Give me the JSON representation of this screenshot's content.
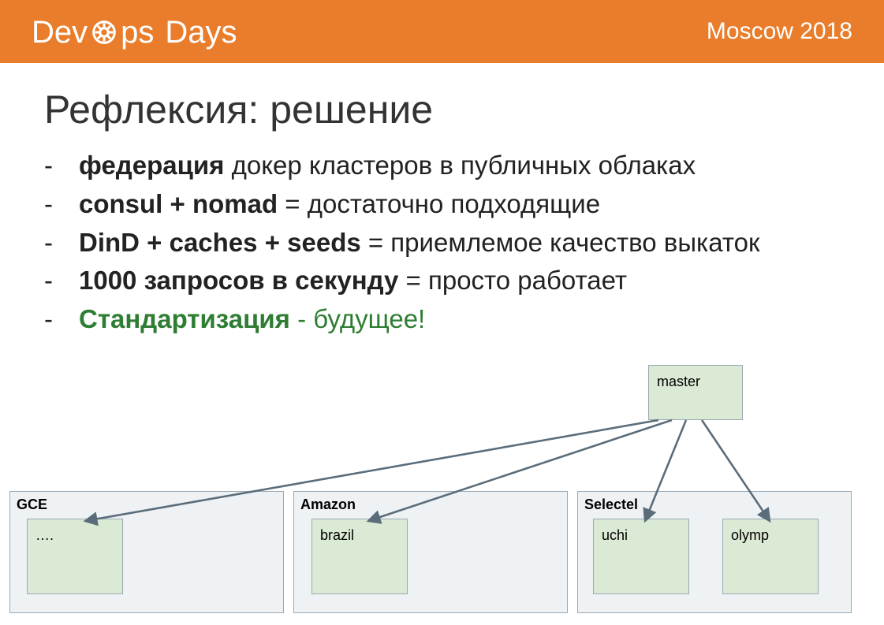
{
  "header": {
    "logo": {
      "dev": "Dev",
      "ps": "ps",
      "days": "Days"
    },
    "event": "Moscow 2018"
  },
  "title": "Рефлексия: решение",
  "bullets": [
    {
      "bold": "федерация",
      "rest": " докер кластеров в публичных облаках",
      "green": false
    },
    {
      "bold": "consul + nomad",
      "rest": " = достаточно подходящие",
      "green": false
    },
    {
      "bold": "DinD + caches + seeds",
      "rest": " = приемлемое качество выкаток",
      "green": false
    },
    {
      "bold": "1000 запросов в секунду",
      "rest": " = просто работает",
      "green": false
    },
    {
      "bold": "Стандартизация",
      "rest": " - будущее!",
      "green": true
    }
  ],
  "diagram": {
    "master": "master",
    "clouds": [
      {
        "label": "GCE",
        "nodes": [
          "…."
        ]
      },
      {
        "label": "Amazon",
        "nodes": [
          "brazil"
        ]
      },
      {
        "label": "Selectel",
        "nodes": [
          "uchi",
          "olymp"
        ]
      }
    ]
  }
}
